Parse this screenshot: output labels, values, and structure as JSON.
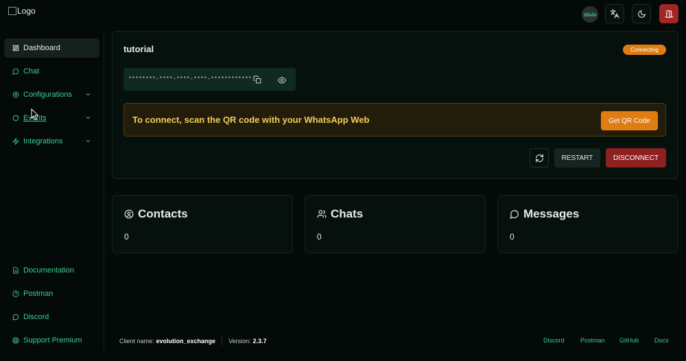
{
  "header": {
    "logo_alt": "Logo",
    "avatar_text": "lululuu"
  },
  "sidebar": {
    "items": [
      {
        "label": "Dashboard",
        "icon": "dashboard-icon",
        "active": true
      },
      {
        "label": "Chat",
        "icon": "chat-icon"
      },
      {
        "label": "Configurations",
        "icon": "settings-icon",
        "has_children": true
      },
      {
        "label": "Events",
        "icon": "events-icon",
        "has_children": true
      },
      {
        "label": "Integrations",
        "icon": "integrations-icon",
        "has_children": true
      }
    ],
    "bottom_items": [
      {
        "label": "Documentation",
        "icon": "document-icon"
      },
      {
        "label": "Postman",
        "icon": "help-circle-icon"
      },
      {
        "label": "Discord",
        "icon": "discord-icon"
      },
      {
        "label": "Support Premium",
        "icon": "support-icon"
      }
    ]
  },
  "instance": {
    "name": "tutorial",
    "status": "Connecting",
    "token_masked": "********-****-****-****-************"
  },
  "qr_banner": {
    "message": "To connect, scan the QR code with your WhatsApp Web",
    "button_label": "Get QR Code"
  },
  "actions": {
    "restart_label": "RESTART",
    "disconnect_label": "DISCONNECT"
  },
  "stats": [
    {
      "title": "Contacts",
      "value": "0",
      "icon": "user-circle-icon"
    },
    {
      "title": "Chats",
      "value": "0",
      "icon": "users-icon"
    },
    {
      "title": "Messages",
      "value": "0",
      "icon": "message-icon"
    }
  ],
  "footer": {
    "client_label": "Client name:",
    "client_name": "evolution_exchange",
    "version_label": "Version:",
    "version": "2.3.7",
    "links": [
      "Discord",
      "Postman",
      "GitHub",
      "Docs"
    ]
  },
  "colors": {
    "accent": "#3ad08f",
    "background": "#040a08",
    "warning": "#df7d12",
    "danger": "#8d2020"
  }
}
